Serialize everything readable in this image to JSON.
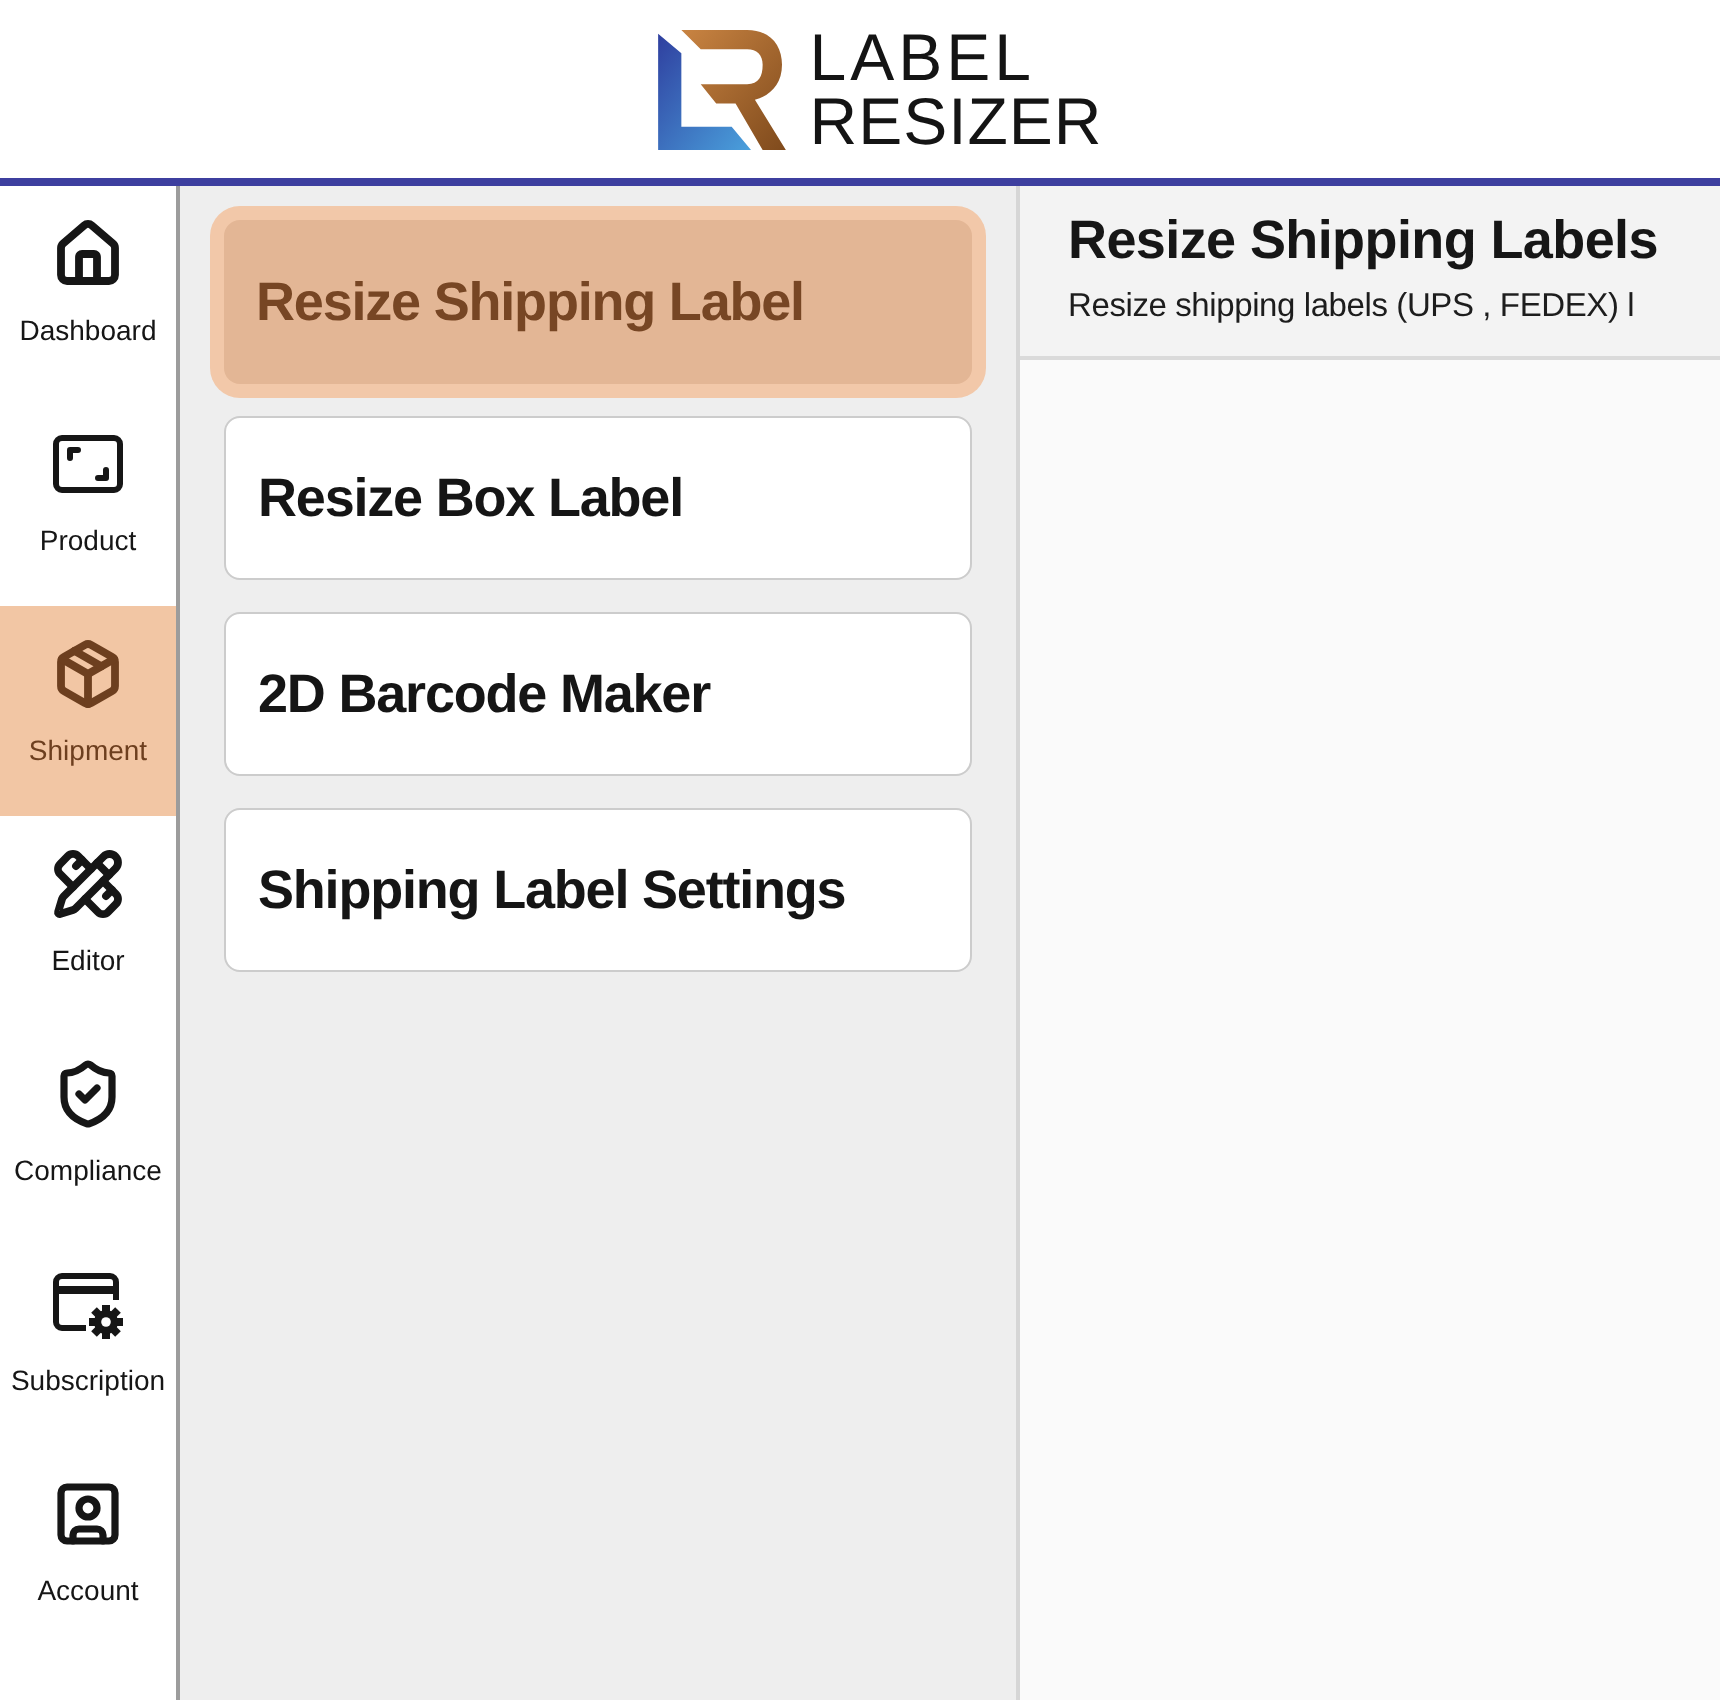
{
  "logo": {
    "line_1": "LABEL",
    "line_2": "RESIZER"
  },
  "sidebar": {
    "items": [
      {
        "label": "Dashboard",
        "selected": false
      },
      {
        "label": "Product",
        "selected": false
      },
      {
        "label": "Shipment",
        "selected": true
      },
      {
        "label": "Editor",
        "selected": false
      },
      {
        "label": "Compliance",
        "selected": false
      },
      {
        "label": "Subscription",
        "selected": false
      },
      {
        "label": "Account",
        "selected": false
      }
    ]
  },
  "menu": {
    "items": [
      {
        "label": "Resize Shipping Label",
        "selected": true
      },
      {
        "label": "Resize Box Label",
        "selected": false
      },
      {
        "label": "2D Barcode Maker",
        "selected": false
      },
      {
        "label": "Shipping Label Settings",
        "selected": false
      }
    ]
  },
  "content": {
    "title": "Resize Shipping Labels",
    "description": "Resize shipping labels (UPS , FEDEX) l"
  }
}
